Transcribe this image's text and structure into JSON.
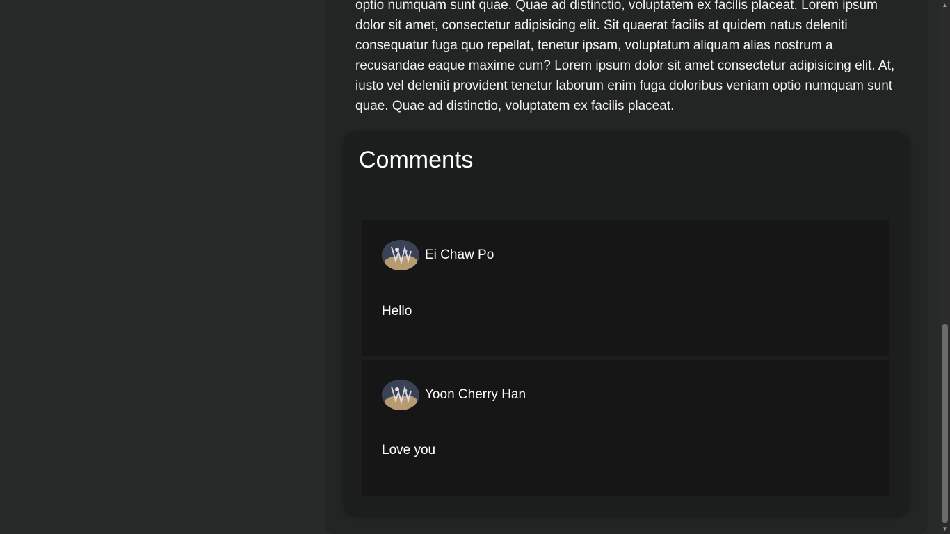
{
  "article": {
    "text": "optio numquam sunt quae. Quae ad distinctio, voluptatem ex facilis placeat. Lorem ipsum dolor sit amet, consectetur adipisicing elit. Sit quaerat facilis at quidem natus deleniti consequatur fuga quo repellat, tenetur ipsam, voluptatum aliquam alias nostrum a recusandae eaque maxime cum? Lorem ipsum dolor sit amet consectetur adipisicing elit. At, iusto vel deleniti provident tenetur laborum enim fuga doloribus veniam optio numquam sunt quae. Quae ad distinctio, voluptatem ex facilis placeat."
  },
  "comments": {
    "title": "Comments",
    "items": [
      {
        "author": "Ei Chaw Po",
        "body": "Hello",
        "avatar_icon": "user-avatar-icon"
      },
      {
        "author": "Yoon Cherry Han",
        "body": "Love you",
        "avatar_icon": "user-avatar-icon"
      }
    ]
  },
  "colors": {
    "page_bg": "#282a2a",
    "panel_bg": "#232424",
    "comments_bg": "#1c1d1d",
    "card_bg": "#161616",
    "text": "#ffffff"
  }
}
